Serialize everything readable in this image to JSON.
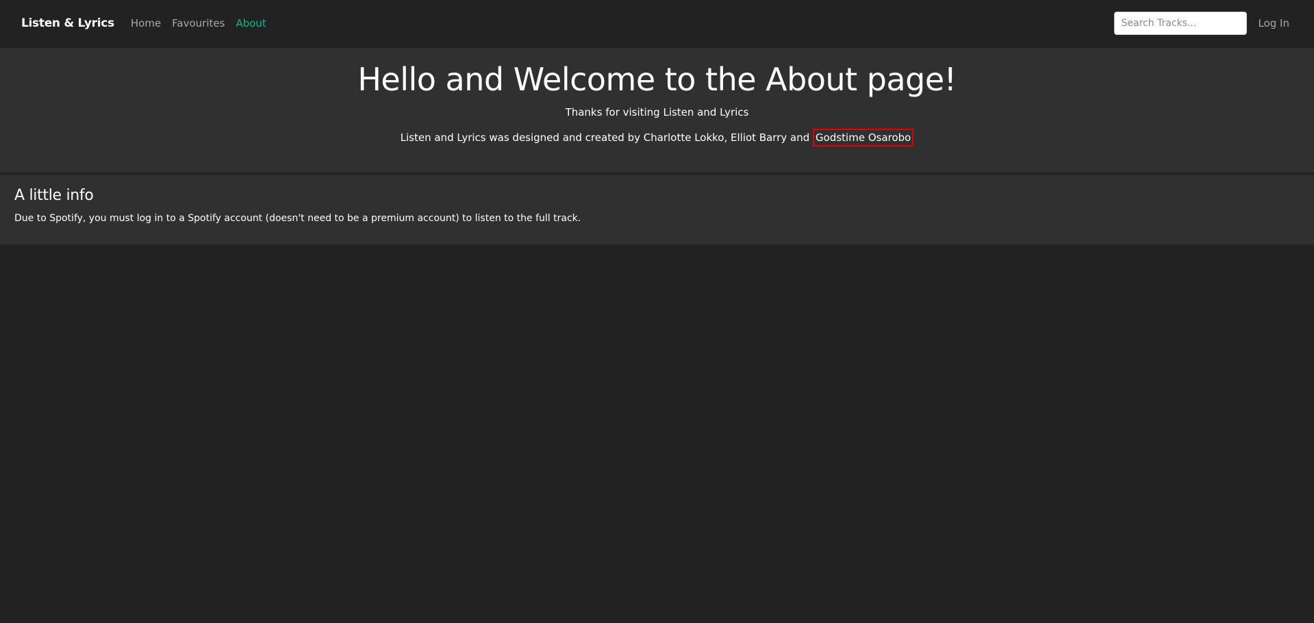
{
  "navbar": {
    "brand": "Listen & Lyrics",
    "links": [
      {
        "label": "Home"
      },
      {
        "label": "Favourites"
      },
      {
        "label": "About"
      }
    ],
    "active_color": "#00bc8c",
    "search": {
      "placeholder": "Search Tracks...",
      "value": ""
    },
    "login_label": "Log In"
  },
  "hero": {
    "title": "Hello and Welcome to the About page!",
    "subtitle": "Thanks for visiting Listen and Lyrics",
    "credits_prefix": "Listen and Lyrics was designed and created by Charlotte Lokko, Elliot Barry and",
    "credits_highlighted": "Godstime Osarobo",
    "highlight_color": "#e00000"
  },
  "info": {
    "heading": "A little info",
    "text": "Due to Spotify, you must log in to a Spotify account (doesn't need to be a premium account) to listen to the full track."
  }
}
